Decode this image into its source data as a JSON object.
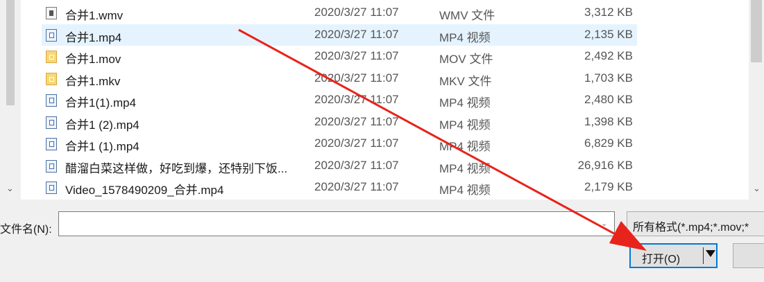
{
  "files": [
    {
      "name": "合并1.wmv",
      "date": "2020/3/27 11:07",
      "type": "WMV 文件",
      "size": "3,312 KB",
      "icon": "wmv-file-icon",
      "selected": false
    },
    {
      "name": "合并1.mp4",
      "date": "2020/3/27 11:07",
      "type": "MP4 视频",
      "size": "2,135 KB",
      "icon": "mp4-file-icon",
      "selected": true
    },
    {
      "name": "合并1.mov",
      "date": "2020/3/27 11:07",
      "type": "MOV 文件",
      "size": "2,492 KB",
      "icon": "mov-file-icon",
      "selected": false
    },
    {
      "name": "合并1.mkv",
      "date": "2020/3/27 11:07",
      "type": "MKV 文件",
      "size": "1,703 KB",
      "icon": "mkv-file-icon",
      "selected": false
    },
    {
      "name": "合并1(1).mp4",
      "date": "2020/3/27 11:07",
      "type": "MP4 视频",
      "size": "2,480 KB",
      "icon": "mp4-file-icon",
      "selected": false
    },
    {
      "name": "合并1 (2).mp4",
      "date": "2020/3/27 11:07",
      "type": "MP4 视频",
      "size": "1,398 KB",
      "icon": "mp4-file-icon",
      "selected": false
    },
    {
      "name": "合并1 (1).mp4",
      "date": "2020/3/27 11:07",
      "type": "MP4 视频",
      "size": "6,829 KB",
      "icon": "mp4-file-icon",
      "selected": false
    },
    {
      "name": "醋溜白菜这样做，好吃到爆，还特别下饭...",
      "date": "2020/3/27 11:07",
      "type": "MP4 视频",
      "size": "26,916 KB",
      "icon": "mp4-file-icon",
      "selected": false
    },
    {
      "name": "Video_1578490209_合并.mp4",
      "date": "2020/3/27 11:07",
      "type": "MP4 视频",
      "size": "2,179 KB",
      "icon": "mp4-file-icon",
      "selected": false
    }
  ],
  "filename": {
    "label": "文件名(N):",
    "value": ""
  },
  "filter": {
    "text": "所有格式(*.mp4;*.mov;*"
  },
  "buttons": {
    "open_label": "打开(O)",
    "cancel_label": ""
  },
  "colors": {
    "selection": "#e5f3ff",
    "accent": "#0078d7",
    "annotation_arrow": "#e8231b"
  },
  "icons": {
    "scroll_down": "chevron-down-icon",
    "combo": "chevron-down-icon",
    "split_dropdown": "triangle-down-icon"
  }
}
